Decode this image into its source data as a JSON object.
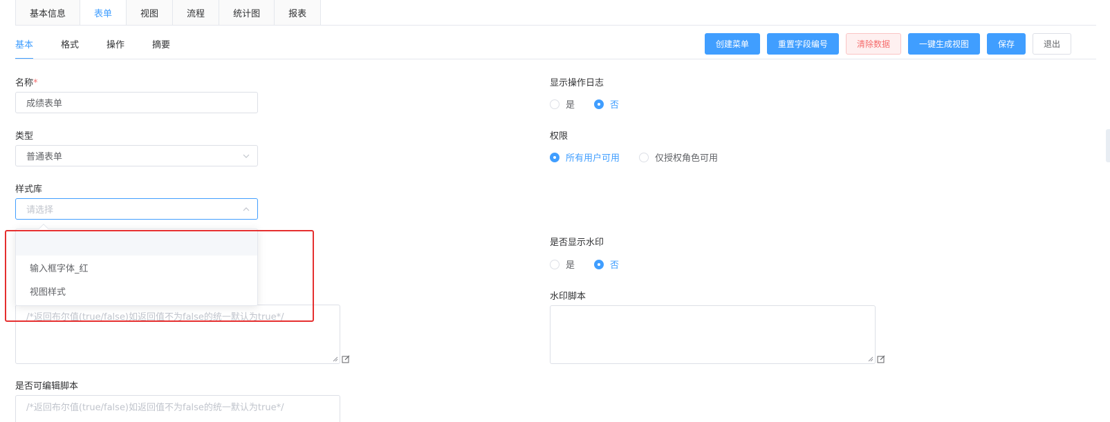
{
  "top_tabs": [
    "基本信息",
    "表单",
    "视图",
    "流程",
    "统计图",
    "报表"
  ],
  "sub_tabs": [
    "基本",
    "格式",
    "操作",
    "摘要"
  ],
  "actions": {
    "create_menu": "创建菜单",
    "reset_field_no": "重置字段编号",
    "clear_data": "清除数据",
    "gen_view": "一键生成视图",
    "save": "保存",
    "exit": "退出"
  },
  "form": {
    "name_label": "名称",
    "name_required": "*",
    "name_value": "成绩表单",
    "type_label": "类型",
    "type_value": "普通表单",
    "style_label": "样式库",
    "style_placeholder": "请选择",
    "style_options": [
      "",
      "输入框字体_红",
      "视图样式"
    ],
    "script1_placeholder": "/*返回布尔值(true/false)如返回值不为false的统一默认为true*/",
    "editable_label": "是否可编辑脚本",
    "editable_placeholder": "/*返回布尔值(true/false)如返回值不为false的统一默认为true*/",
    "log_label": "显示操作日志",
    "log_options": [
      "是",
      "否"
    ],
    "perm_label": "权限",
    "perm_options": [
      "所有用户可用",
      "仅授权角色可用"
    ],
    "watermark_label": "是否显示水印",
    "watermark_options": [
      "是",
      "否"
    ],
    "watermark_script_label": "水印脚本"
  },
  "colors": {
    "primary": "#409eff",
    "danger": "#f56c6c",
    "highlight": "#e52e2e"
  }
}
